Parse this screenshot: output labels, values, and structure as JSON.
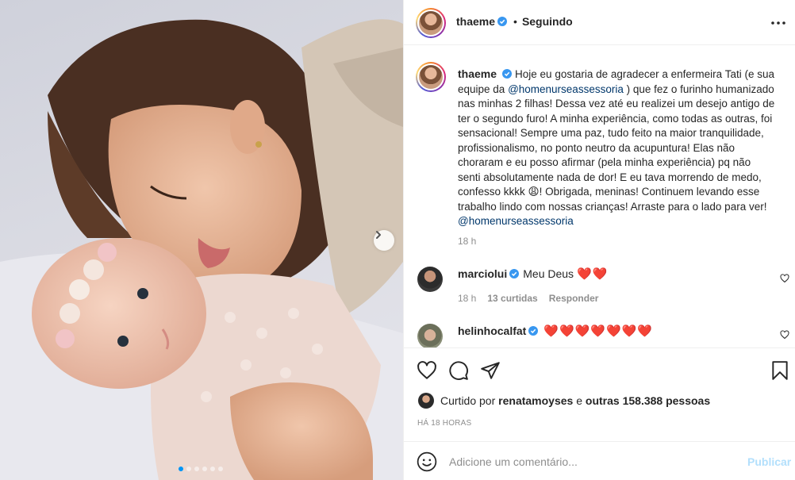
{
  "post": {
    "username": "thaeme",
    "follow_status": "Seguindo",
    "separator": "•",
    "more_icon": "more-horizontal-icon",
    "carousel": {
      "count": 6,
      "active_index": 0
    }
  },
  "caption": {
    "username": "thaeme",
    "text_1": "Hoje eu gostaria de agradecer a enfermeira Tati (e sua equipe da ",
    "mention_1": "@homenurseassessoria",
    "text_2": " ) que fez o furinho humanizado nas minhas 2 filhas! Dessa vez até eu realizei um desejo antigo de ter o segundo furo! A minha experiência, como todas as outras, foi sensacional! Sempre uma paz, tudo feito na maior tranquilidade, profissionalismo, no ponto neutro da acupuntura! Elas não choraram e eu posso afirmar (pela minha experiência) pq não senti absolutamente nada de dor! E eu tava morrendo de medo, confesso kkkk 😩! Obrigada, meninas! Continuem levando esse trabalho lindo com nossas crianças! Arraste para o lado para ver!",
    "mention_2": "@homenurseassessoria",
    "time": "18 h"
  },
  "comments": [
    {
      "username": "marciolui",
      "verified": true,
      "text": "Meu Deus",
      "emoji": "❤️❤️",
      "time": "18 h",
      "likes": "13 curtidas",
      "reply_label": "Responder"
    },
    {
      "username": "helinhocalfat",
      "verified": true,
      "text": "",
      "emoji": "❤️❤️❤️❤️❤️❤️❤️"
    }
  ],
  "actions": {
    "like_icon": "heart-icon",
    "comment_icon": "comment-icon",
    "share_icon": "paper-plane-icon",
    "save_icon": "bookmark-icon"
  },
  "likes": {
    "prefix": "Curtido por ",
    "user": "renatamoyses",
    "middle": " e ",
    "others": "outras 158.388 pessoas"
  },
  "timestamp": "HÁ 18 HORAS",
  "add_comment": {
    "placeholder": "Adicione um comentário...",
    "post_label": "Publicar",
    "emoji_icon": "smiley-icon"
  },
  "colors": {
    "verified": "#3897f0",
    "link": "#00376b",
    "publish_disabled": "#b2dffc",
    "heart": "#ed1c24"
  }
}
